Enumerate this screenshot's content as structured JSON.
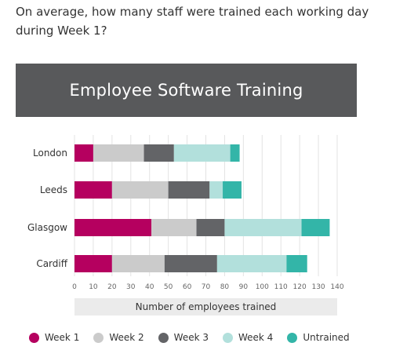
{
  "question": "On average, how many staff were trained each working day during Week 1?",
  "chart_data": {
    "type": "bar",
    "orientation": "horizontal",
    "stacked": true,
    "title": "Employee Software Training",
    "xlabel": "Number of employees trained",
    "ylabel": "",
    "xlim": [
      0,
      140
    ],
    "xticks": [
      0,
      10,
      20,
      30,
      40,
      50,
      60,
      70,
      80,
      90,
      100,
      110,
      120,
      130,
      140
    ],
    "grid": true,
    "legend_position": "bottom",
    "categories": [
      "London",
      "Leeds",
      "Glasgow",
      "Cardiff"
    ],
    "series": [
      {
        "name": "Week 1",
        "color": "#b5005f",
        "values": [
          10,
          20,
          41,
          20
        ]
      },
      {
        "name": "Week 2",
        "color": "#cbcbcb",
        "values": [
          27,
          30,
          24,
          28
        ]
      },
      {
        "name": "Week 3",
        "color": "#636467",
        "values": [
          16,
          22,
          15,
          28
        ]
      },
      {
        "name": "Week 4",
        "color": "#b2e0dc",
        "values": [
          30,
          7,
          41,
          37
        ]
      },
      {
        "name": "Untrained",
        "color": "#33b5a8",
        "values": [
          5,
          10,
          15,
          11
        ]
      }
    ]
  }
}
